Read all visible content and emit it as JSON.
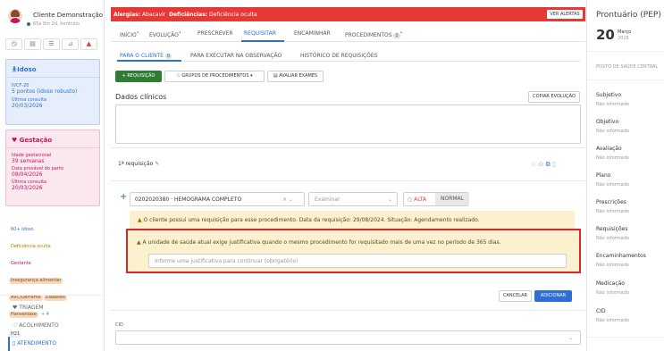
{
  "patient": {
    "name": "Cliente Demonstração",
    "info": "65a 8m 2d, feminino"
  },
  "toolbar": {
    "icons": [
      "clock-icon",
      "document-icon",
      "list-icon",
      "chart-icon",
      "alert-icon"
    ]
  },
  "idoso_card": {
    "title": "Idoso",
    "ivcf_label": "IVCF-20",
    "ivcf_value": "5 pontos (idoso robusto)",
    "last_label": "Última consulta",
    "last_value": "20/03/2026"
  },
  "gestacao_card": {
    "title": "Gestação",
    "ig_label": "Idade gestacional",
    "ig_value": "39 semanas",
    "dpp_label": "Data provável do parto",
    "dpp_value": "08/04/2026",
    "last_label": "Última consulta",
    "last_value": "20/03/2026"
  },
  "tags": {
    "t1": "60+ Idoso",
    "t2": "Deficiência oculta",
    "t3": "Gestante",
    "t4": "Insegurança alimentar",
    "t5": "AVC/Derrame",
    "t6": "Diabetes",
    "t7": "Hanseníase",
    "more": "+ 4",
    "t8": "H21"
  },
  "nav": {
    "triagem": "TRIAGEM",
    "acolhimento": "ACOLHIMENTO",
    "atendimento": "ATENDIMENTO"
  },
  "alert_bar": {
    "alergias_label": "Alergias:",
    "alergias_value": "Abacavir",
    "def_label": "Deficiências:",
    "def_value": "Deficiência oculta",
    "button": "VER ALERTAS"
  },
  "main_tabs": {
    "inicio": "INÍCIO",
    "evolucao": "EVOLUÇÃO",
    "prescrever": "PRESCREVER",
    "requisitar": "REQUISITAR",
    "encaminhar": "ENCAMINHAR",
    "procedimentos": "PROCEDIMENTOS",
    "proc_count": "1"
  },
  "sub_tabs": {
    "cliente": "PARA O CLIENTE",
    "cliente_count": "0",
    "obs": "PARA EXECUTAR NA OBSERVAÇÃO",
    "hist": "HISTÓRICO DE REQUISIÇÕES"
  },
  "actions": {
    "requisicao": "+ REQUISIÇÃO",
    "grupos": "GRUPOS DE PROCEDIMENTOS",
    "avaliar": "AVALIAR EXAMES"
  },
  "dados": {
    "title": "Dados clínicos",
    "copy": "COPIAR EVOLUÇÃO"
  },
  "req": {
    "title": "1ª requisição",
    "proc_code": "0202020380 · HEMOGRAMA COMPLETO",
    "exam_placeholder": "Examinar",
    "alta": "ALTA",
    "normal": "NORMAL"
  },
  "warn1": "O cliente possui uma requisição para esse procedimento. Data da requisição: 29/08/2024. Situação: Agendamento realizado.",
  "warn2": "A unidade de saúde atual exige justificativa quando o mesmo procedimento for requisitado mais de uma vez no período de 365 dias.",
  "justificativa_placeholder": "Informe uma justificativa para continuar (obrigatório)",
  "buttons": {
    "cancelar": "CANCELAR",
    "adicionar": "ADICIONAR"
  },
  "cid_label": "CID",
  "right": {
    "title": "Prontuário (PEP)",
    "day": "20",
    "month": "Março",
    "year": "2026",
    "posto": "POSTO DE SAÚDE CENTRAL",
    "sections": [
      {
        "label": "Subjetivo",
        "value": "Não informado"
      },
      {
        "label": "Objetivo",
        "value": "Não informado"
      },
      {
        "label": "Avaliação",
        "value": "Não informado"
      },
      {
        "label": "Plano",
        "value": "Não informado"
      },
      {
        "label": "Prescrições",
        "value": "Não informado"
      },
      {
        "label": "Requisições",
        "value": "Não informado"
      },
      {
        "label": "Encaminhamentos",
        "value": "Não informado"
      },
      {
        "label": "Medicação",
        "value": "Não informado"
      },
      {
        "label": "CID",
        "value": "Não informado"
      }
    ]
  },
  "colors": {
    "red": "#e53935",
    "blue": "#2d6fd5",
    "green": "#2e7d32",
    "warn_bg": "#fbf1cf",
    "idoso_bg": "#e6eefb",
    "gest_bg": "#fbe7ee"
  }
}
